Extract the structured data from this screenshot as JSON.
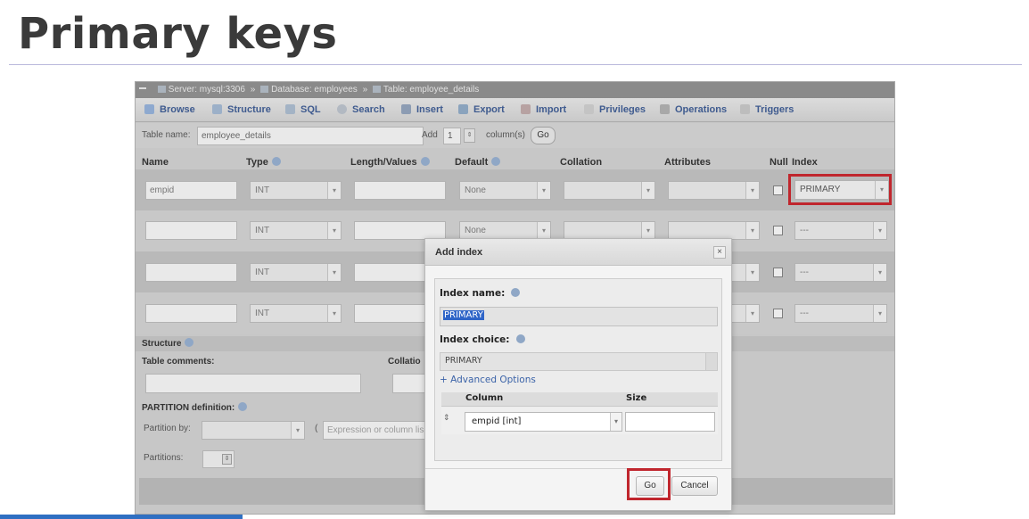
{
  "slide": {
    "title": "Primary keys"
  },
  "breadcrumb": {
    "server": "Server: mysql:3306",
    "database": "Database: employees",
    "table": "Table: employee_details",
    "sep": "»"
  },
  "tabs": [
    {
      "label": "Browse",
      "icon": "browse-icon"
    },
    {
      "label": "Structure",
      "icon": "structure-icon"
    },
    {
      "label": "SQL",
      "icon": "sql-icon"
    },
    {
      "label": "Search",
      "icon": "search-icon"
    },
    {
      "label": "Insert",
      "icon": "insert-icon"
    },
    {
      "label": "Export",
      "icon": "export-icon"
    },
    {
      "label": "Import",
      "icon": "import-icon"
    },
    {
      "label": "Privileges",
      "icon": "privileges-icon"
    },
    {
      "label": "Operations",
      "icon": "operations-icon"
    },
    {
      "label": "Triggers",
      "icon": "triggers-icon"
    }
  ],
  "table_name": {
    "label": "Table name:",
    "value": "employee_details",
    "add_label": "Add",
    "add_count": "1",
    "columns_label": "column(s)",
    "go_label": "Go"
  },
  "columns_header": {
    "name": "Name",
    "type": "Type",
    "length": "Length/Values",
    "default": "Default",
    "collation": "Collation",
    "attributes": "Attributes",
    "null": "Null",
    "index": "Index"
  },
  "rows": [
    {
      "name": "empid",
      "type": "INT",
      "default": "None",
      "index": "PRIMARY"
    },
    {
      "name": "",
      "type": "INT",
      "default": "None",
      "index": "---"
    },
    {
      "name": "",
      "type": "INT",
      "default": "",
      "index": "---"
    },
    {
      "name": "",
      "type": "INT",
      "default": "",
      "index": "---"
    }
  ],
  "structure": {
    "header": "Structure",
    "table_comments": "Table comments:",
    "collation": "Collatio",
    "partition_definition": "PARTITION definition:",
    "partition_by": "Partition by:",
    "paren": "(",
    "expression_placeholder": "Expression or column lis",
    "partitions": "Partitions:"
  },
  "dialog": {
    "title": "Add index",
    "close": "×",
    "index_name_label": "Index name:",
    "index_name_value": "PRIMARY",
    "index_choice_label": "Index choice:",
    "index_choice_value": "PRIMARY",
    "advanced_options": "+ Advanced Options",
    "column_header": "Column",
    "size_header": "Size",
    "column_value": "empid [int]",
    "drag_handle": "⇕",
    "go": "Go",
    "cancel": "Cancel"
  },
  "colors": {
    "highlight": "#c0262d",
    "link": "#3b63a8",
    "selection": "#2f65c8"
  }
}
